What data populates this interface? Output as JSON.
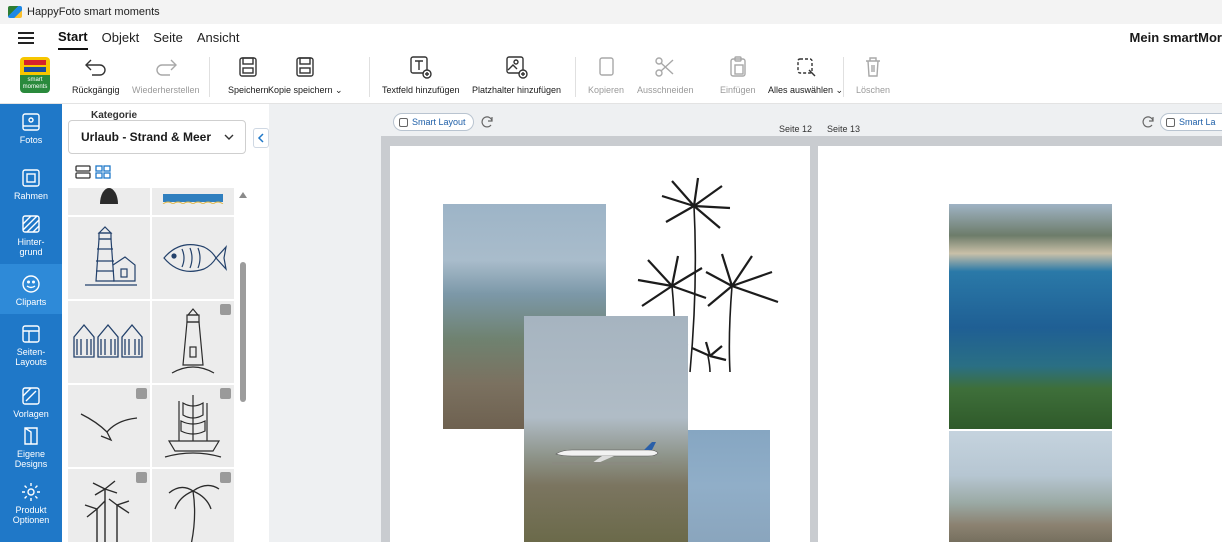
{
  "window": {
    "title": "HappyFoto smart moments"
  },
  "menu": {
    "tabs": [
      {
        "label": "Start",
        "active": true
      },
      {
        "label": "Objekt"
      },
      {
        "label": "Seite"
      },
      {
        "label": "Ansicht"
      }
    ],
    "project_name": "Mein smartMor"
  },
  "brand": {
    "logo_text": "smart moments"
  },
  "toolbar": {
    "undo": "Rückgängig",
    "redo": "Wiederherstellen",
    "save": "Speichern",
    "save_copy": "Kopie speichern ⌄",
    "add_textbox": "Textfeld hinzufügen",
    "add_placeholder": "Platzhalter hinzufügen",
    "copy": "Kopieren",
    "cut": "Ausschneiden",
    "paste": "Einfügen",
    "select_all": "Alles auswählen ⌄",
    "delete": "Löschen"
  },
  "sidenav": [
    {
      "icon": "photo-icon",
      "label": "Fotos"
    },
    {
      "icon": "frame-icon",
      "label": "Rahmen"
    },
    {
      "icon": "background-icon",
      "label": "Hinter-\ngrund"
    },
    {
      "icon": "clipart-icon",
      "label": "Cliparts",
      "active": true
    },
    {
      "icon": "layout-icon",
      "label": "Seiten-\nLayouts"
    },
    {
      "icon": "template-icon",
      "label": "Vorlagen"
    },
    {
      "icon": "design-icon",
      "label": "Eigene\nDesigns"
    },
    {
      "icon": "gear-icon",
      "label": "Produkt\nOptionen"
    }
  ],
  "panel": {
    "category_label": "Kategorie",
    "category_value": "Urlaub - Strand & Meer",
    "cliparts": [
      {
        "name": "surfboard",
        "premium": false
      },
      {
        "name": "beach-border",
        "premium": false
      },
      {
        "name": "lighthouse-house",
        "premium": false
      },
      {
        "name": "fish",
        "premium": false
      },
      {
        "name": "beach-huts",
        "premium": false
      },
      {
        "name": "lighthouse",
        "premium": true
      },
      {
        "name": "seagull",
        "premium": true
      },
      {
        "name": "sailing-ship",
        "premium": true
      },
      {
        "name": "palm-trees",
        "premium": true
      },
      {
        "name": "palm-tree",
        "premium": true
      }
    ]
  },
  "canvas": {
    "smart_layout": "Smart Layout",
    "smart_layout_right": "Smart La",
    "page_left": "Seite 12",
    "page_right": "Seite 13"
  },
  "colors": {
    "accent": "#1f78c8",
    "canvas_bg": "#eef0f2"
  }
}
